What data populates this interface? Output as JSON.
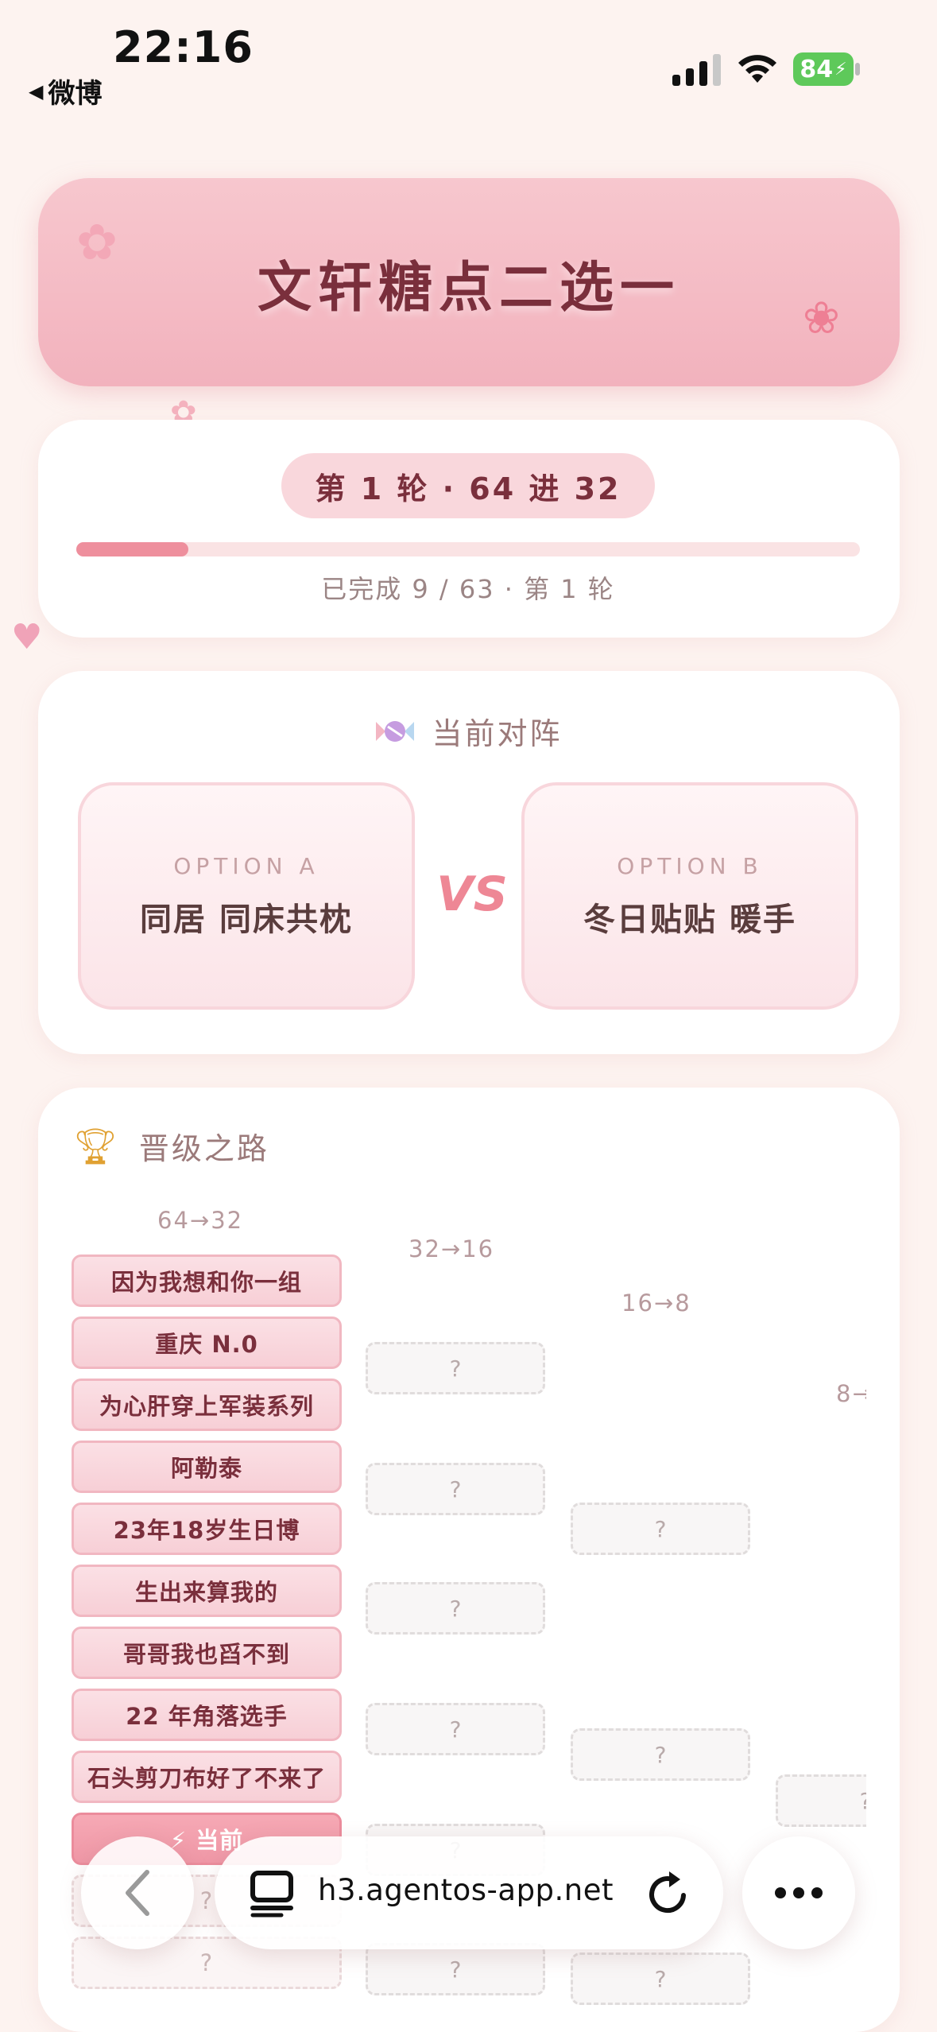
{
  "status_bar": {
    "time": "22:16",
    "back_app": "微博",
    "battery": "84"
  },
  "header": {
    "title": "文轩糖点二选一"
  },
  "progress": {
    "round_label": "第 1 轮 · 64 进 32",
    "completed_text": "已完成 9 / 63 · 第 1 轮",
    "completed": 9,
    "total": 63,
    "fraction": 0.143
  },
  "matchup": {
    "heading": "当前对阵",
    "option_a": {
      "label": "OPTION A",
      "text": "同居 同床共枕"
    },
    "vs": "VS",
    "option_b": {
      "label": "OPTION B",
      "text": "冬日贴贴 暖手"
    }
  },
  "bracket": {
    "heading": "晋级之路",
    "columns": [
      "64→32",
      "32→16",
      "16→8",
      "8→"
    ],
    "round1": [
      "因为我想和你一组",
      "重庆 N.0",
      "为心肝穿上军装系列",
      "阿勒泰",
      "23年18岁生日博",
      "生出来算我的",
      "哥哥我也舀不到",
      "22 年角落选手",
      "石头剪刀布好了不来了"
    ],
    "current_label": "⚡ 当前",
    "unknown": "?"
  },
  "browser": {
    "url": "h3.agentos-app.net"
  },
  "colors": {
    "accent": "#ee8f9d",
    "title": "#7a2f3c",
    "background": "#fdf3f0"
  },
  "icons": [
    "cellular-signal-icon",
    "wifi-icon",
    "battery-icon",
    "candy-icon",
    "trophy-icon",
    "back-chevron-icon",
    "tabs-icon",
    "reload-icon",
    "more-icon",
    "flower-icon",
    "tulip-icon",
    "heart-icon"
  ]
}
